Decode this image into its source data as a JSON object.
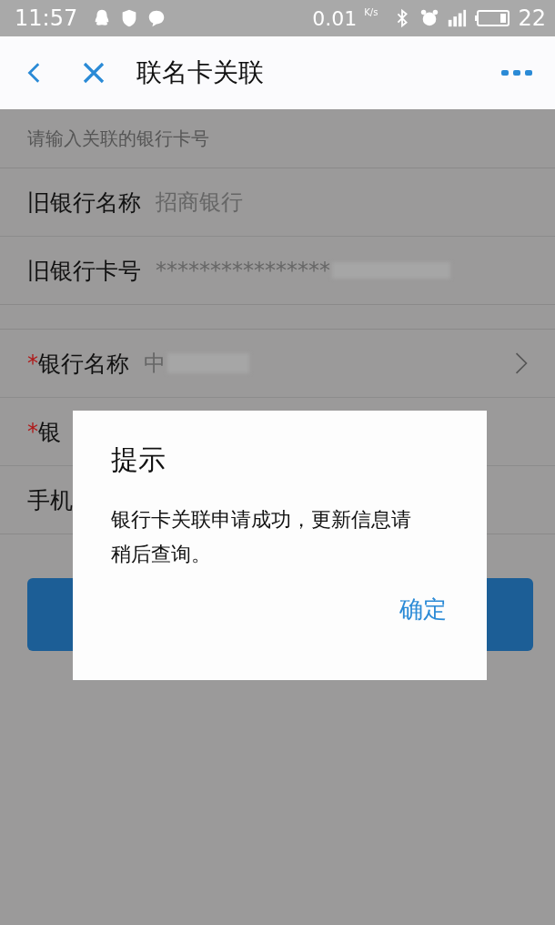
{
  "status_bar": {
    "time": "11:57",
    "speed": "0.01",
    "speed_unit": "K/s",
    "battery": "22"
  },
  "nav": {
    "title": "联名卡关联"
  },
  "section_header": "请输入关联的银行卡号",
  "old_card": [
    {
      "label": "旧银行名称",
      "value": "招商银行",
      "masked": false
    },
    {
      "label": "旧银行卡号",
      "value": "****************",
      "masked": true
    }
  ],
  "new_card": [
    {
      "label": "银行名称",
      "required": true,
      "required_mark": "*",
      "value": "中",
      "masked": true,
      "chevron": true
    },
    {
      "label": "银",
      "required": true,
      "required_mark": "*",
      "masked": false,
      "chevron": false
    },
    {
      "label": "手机",
      "required": false,
      "masked": false,
      "chevron": false
    }
  ],
  "dialog": {
    "title": "提示",
    "message": "银行卡关联申请成功，更新信息请稍后查询。",
    "button": "确定"
  }
}
